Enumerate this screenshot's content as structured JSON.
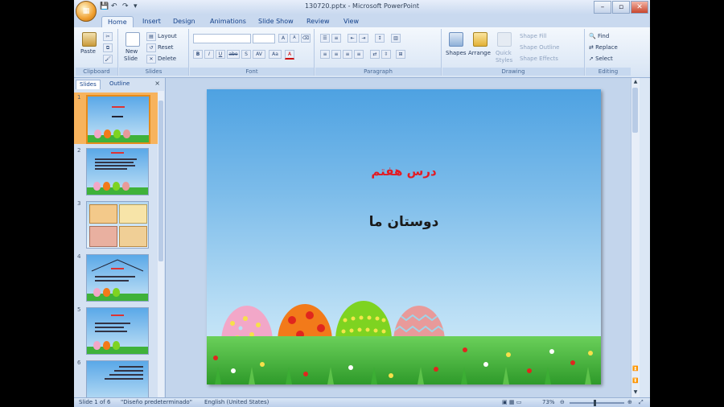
{
  "window": {
    "title": "130720.pptx - Microsoft PowerPoint",
    "office_button_icon": "office-logo-icon"
  },
  "tabs": [
    "Home",
    "Insert",
    "Design",
    "Animations",
    "Slide Show",
    "Review",
    "View"
  ],
  "active_tab": "Home",
  "ribbon": {
    "clipboard": {
      "paste": "Paste",
      "label": "Clipboard"
    },
    "slides": {
      "new_slide": "New",
      "new_slide2": "Slide",
      "layout": "Layout",
      "reset": "Reset",
      "delete": "Delete",
      "label": "Slides"
    },
    "font": {
      "label": "Font",
      "bold": "B",
      "italic": "I",
      "underline": "U",
      "strike": "abe",
      "shadow": "S",
      "spacing": "AV",
      "case": "Aa",
      "color": "A",
      "grow": "A",
      "shrink": "A",
      "clear": "⌫"
    },
    "paragraph": {
      "label": "Paragraph"
    },
    "drawing": {
      "shapes": "Shapes",
      "arrange": "Arrange",
      "quick_styles": "Quick",
      "quick_styles2": "Styles",
      "shape_fill": "Shape Fill",
      "shape_outline": "Shape Outline",
      "shape_effects": "Shape Effects",
      "label": "Drawing"
    },
    "editing": {
      "find": "Find",
      "replace": "Replace",
      "select": "Select",
      "label": "Editing"
    }
  },
  "left_pane": {
    "tab_slides": "Slides",
    "tab_outline": "Outline",
    "close": "×",
    "thumbnails": [
      {
        "num": "1"
      },
      {
        "num": "2"
      },
      {
        "num": "3"
      },
      {
        "num": "4"
      },
      {
        "num": "5"
      },
      {
        "num": "6"
      }
    ]
  },
  "slide": {
    "title": "درس هفتم",
    "subtitle": "دوستان ما",
    "title_color": "#e31b23",
    "egg_colors": [
      "#f2a7c8",
      "#f27a1a",
      "#7ed321",
      "#e89a9a"
    ]
  },
  "status": {
    "slide_of": "Slide 1 of 6",
    "theme": "\"Diseño predeterminado\"",
    "language": "English (United States)",
    "zoom": "73%"
  }
}
